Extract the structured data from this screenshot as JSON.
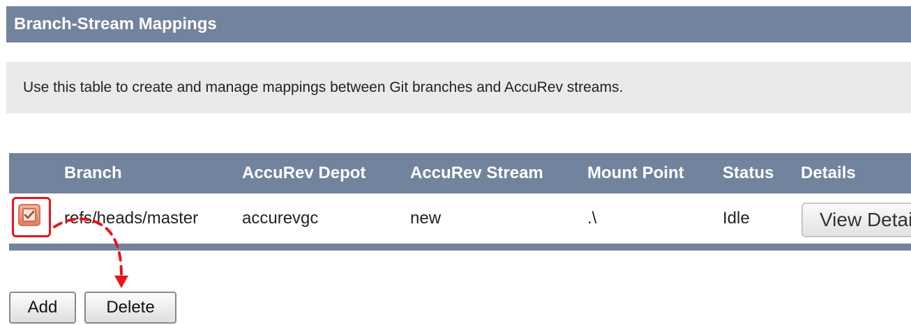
{
  "header": {
    "title": "Branch-Stream Mappings"
  },
  "info": {
    "text": "Use this table to create and manage mappings between Git branches and AccuRev streams."
  },
  "table": {
    "columns": [
      "Branch",
      "AccuRev Depot",
      "AccuRev Stream",
      "Mount Point",
      "Status",
      "Details"
    ],
    "rows": [
      {
        "checked": true,
        "branch": "refs/heads/master",
        "depot": "accurevgc",
        "stream": "new",
        "mount_point": ".\\",
        "status": "Idle",
        "details_button": "View Details"
      }
    ]
  },
  "actions": {
    "add_label": "Add",
    "delete_label": "Delete"
  },
  "colors": {
    "header_bg": "#72839e",
    "info_bg": "#eaeaea",
    "highlight_red": "#e8141e",
    "checkbox_orange": "#e57e5c"
  },
  "icons": [
    "checkmark-icon",
    "annotation-arrow-icon"
  ]
}
